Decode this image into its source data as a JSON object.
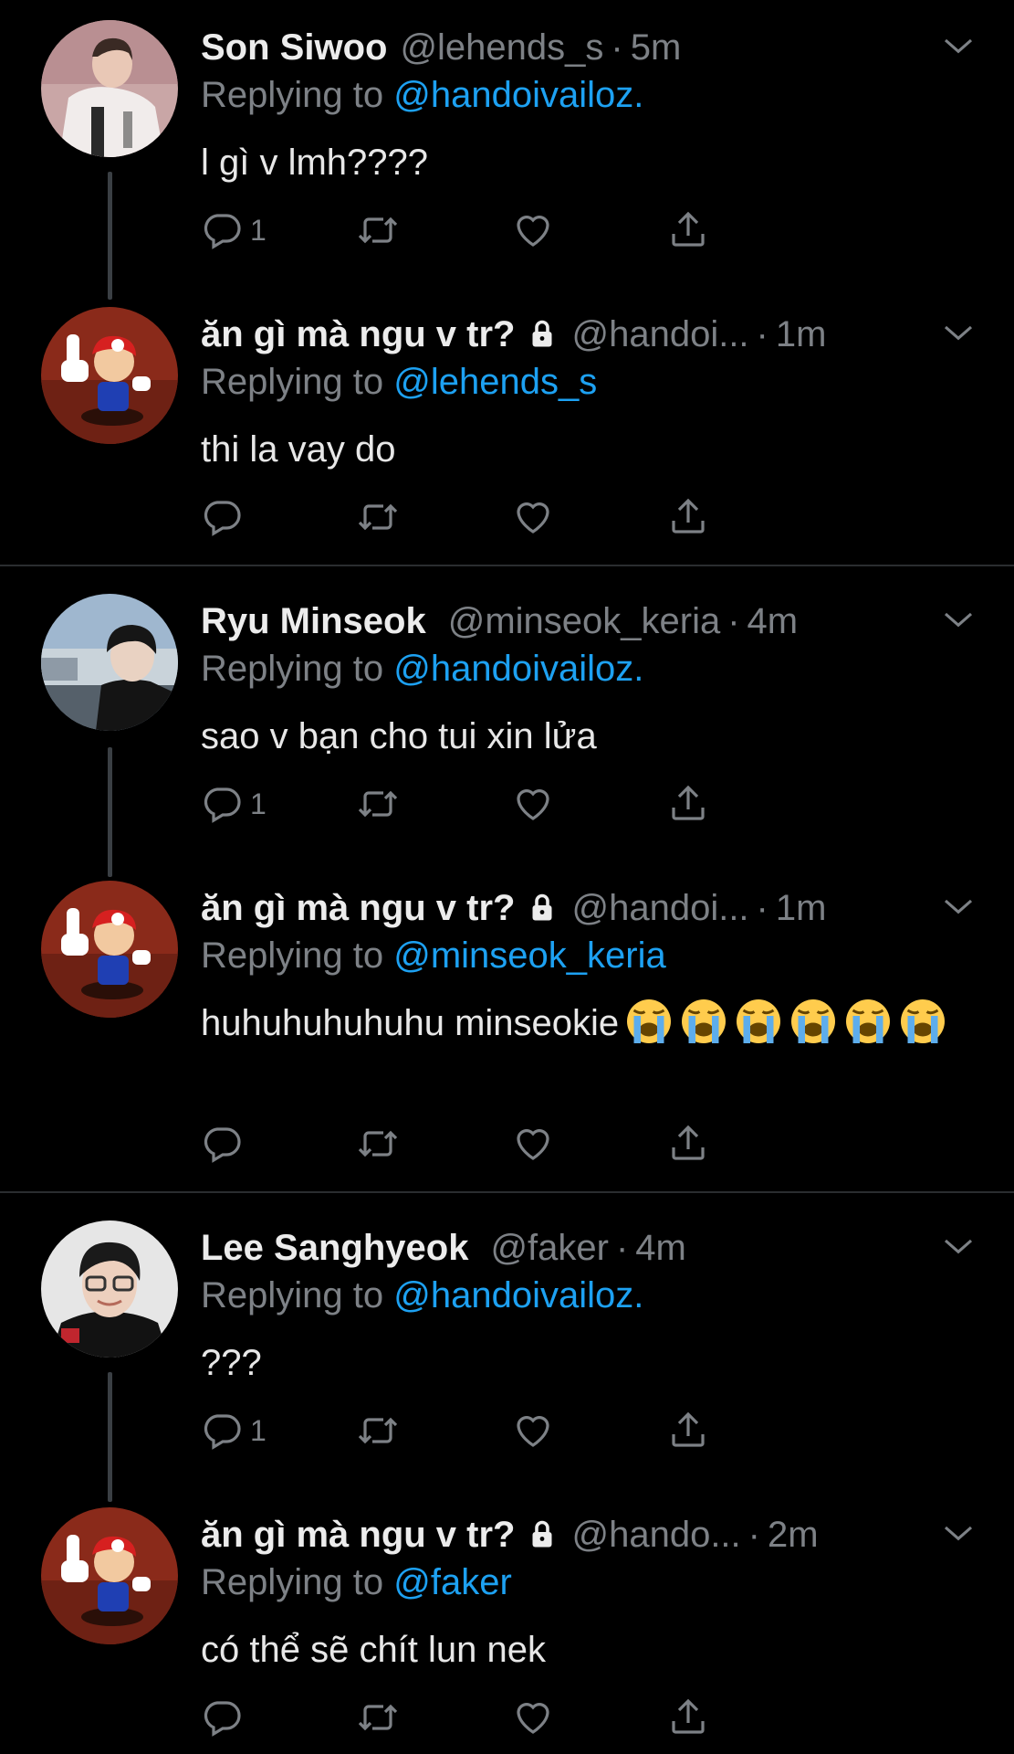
{
  "tweets": [
    {
      "name": "Son Siwoo",
      "handle": "@lehends_s",
      "time": "5m",
      "replying_prefix": "Replying to ",
      "replying_to": "@handoivailoz.",
      "text": "l gì v lmh????",
      "reply_count": "1",
      "locked": false,
      "avatar": "lehends-avatar"
    },
    {
      "name": "ăn gì mà ngu v tr?",
      "handle": "@handoi...",
      "time": "1m",
      "replying_prefix": "Replying to ",
      "replying_to": "@lehends_s",
      "text": "thi la vay do",
      "reply_count": "",
      "locked": true,
      "avatar": "mario-middle-finger-avatar"
    },
    {
      "name": "Ryu Minseok",
      "handle": "@minseok_keria",
      "time": "4m",
      "replying_prefix": "Replying to ",
      "replying_to": "@handoivailoz.",
      "text": "sao v bạn cho tui xin lửa",
      "reply_count": "1",
      "locked": false,
      "avatar": "keria-avatar"
    },
    {
      "name": "ăn gì mà ngu v tr?",
      "handle": "@handoi...",
      "time": "1m",
      "replying_prefix": "Replying to ",
      "replying_to": "@minseok_keria",
      "text": "huhuhuhuhuhu minseokie",
      "emoji_count": 6,
      "reply_count": "",
      "locked": true,
      "avatar": "mario-middle-finger-avatar"
    },
    {
      "name": "Lee Sanghyeok",
      "handle": "@faker",
      "time": "4m",
      "replying_prefix": "Replying to ",
      "replying_to": "@handoivailoz.",
      "text": "???",
      "reply_count": "1",
      "locked": false,
      "avatar": "faker-avatar"
    },
    {
      "name": "ăn gì mà ngu v tr?",
      "handle": "@hando...",
      "time": "2m",
      "replying_prefix": "Replying to ",
      "replying_to": "@faker",
      "text": "có thể sẽ chít lun nek",
      "reply_count": "",
      "locked": true,
      "avatar": "mario-middle-finger-avatar"
    }
  ],
  "separator": "·",
  "colors": {
    "background": "#000000",
    "mention": "#1da1f2",
    "muted": "#7d8186",
    "text": "#e7e7e7"
  },
  "icons": [
    "reply-icon",
    "retweet-icon",
    "like-icon",
    "share-icon",
    "caret-down-icon",
    "lock-icon",
    "loudly-crying-face-emoji"
  ]
}
